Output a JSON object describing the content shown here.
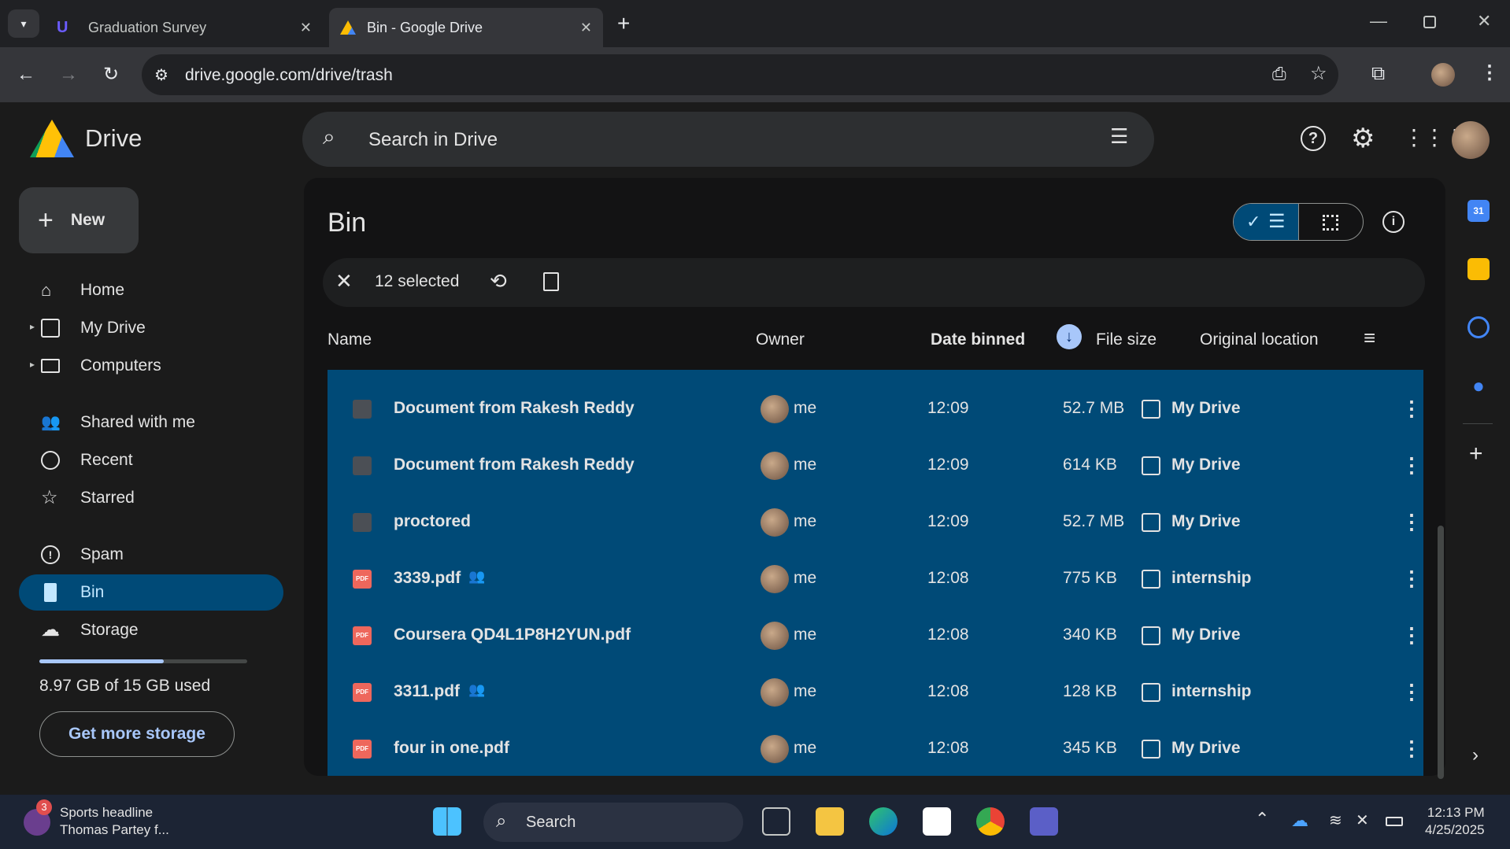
{
  "browser": {
    "tabs": [
      {
        "title": "Graduation Survey",
        "active": false
      },
      {
        "title": "Bin - Google Drive",
        "active": true
      }
    ],
    "url": "drive.google.com/drive/trash"
  },
  "drive": {
    "app_name": "Drive",
    "search_placeholder": "Search in Drive",
    "new_label": "New",
    "nav": [
      {
        "label": "Home"
      },
      {
        "label": "My Drive"
      },
      {
        "label": "Computers"
      },
      {
        "label": "Shared with me"
      },
      {
        "label": "Recent"
      },
      {
        "label": "Starred"
      },
      {
        "label": "Spam"
      },
      {
        "label": "Bin"
      },
      {
        "label": "Storage"
      }
    ],
    "storage": {
      "text": "8.97 GB of 15 GB used",
      "used_fraction": 0.598,
      "button": "Get more storage"
    },
    "page_title": "Bin",
    "selection": {
      "count_label": "12 selected"
    },
    "columns": {
      "name": "Name",
      "owner": "Owner",
      "date": "Date binned",
      "size": "File size",
      "location": "Original location"
    },
    "files": [
      {
        "name": "Document from Rakesh Reddy",
        "type": "doc",
        "shared": false,
        "owner": "me",
        "date": "12:09",
        "size": "52.7 MB",
        "location": "My Drive"
      },
      {
        "name": "Document from Rakesh Reddy",
        "type": "doc",
        "shared": false,
        "owner": "me",
        "date": "12:09",
        "size": "614 KB",
        "location": "My Drive"
      },
      {
        "name": "proctored",
        "type": "doc",
        "shared": false,
        "owner": "me",
        "date": "12:09",
        "size": "52.7 MB",
        "location": "My Drive"
      },
      {
        "name": "3339.pdf",
        "type": "pdf",
        "shared": true,
        "owner": "me",
        "date": "12:08",
        "size": "775 KB",
        "location": "internship"
      },
      {
        "name": "Coursera QD4L1P8H2YUN.pdf",
        "type": "pdf",
        "shared": false,
        "owner": "me",
        "date": "12:08",
        "size": "340 KB",
        "location": "My Drive"
      },
      {
        "name": "3311.pdf",
        "type": "pdf",
        "shared": true,
        "owner": "me",
        "date": "12:08",
        "size": "128 KB",
        "location": "internship"
      },
      {
        "name": "four in one.pdf",
        "type": "pdf",
        "shared": false,
        "owner": "me",
        "date": "12:08",
        "size": "345 KB",
        "location": "My Drive"
      }
    ],
    "pdf_badge": "PDF"
  },
  "taskbar": {
    "news_title": "Sports headline",
    "news_sub": "Thomas Partey f...",
    "news_badge": "3",
    "search_label": "Search",
    "time": "12:13 PM",
    "date": "4/25/2025"
  },
  "colors": {
    "accent": "#004a77",
    "link": "#a8c7fa",
    "pdf": "#ee675c"
  }
}
